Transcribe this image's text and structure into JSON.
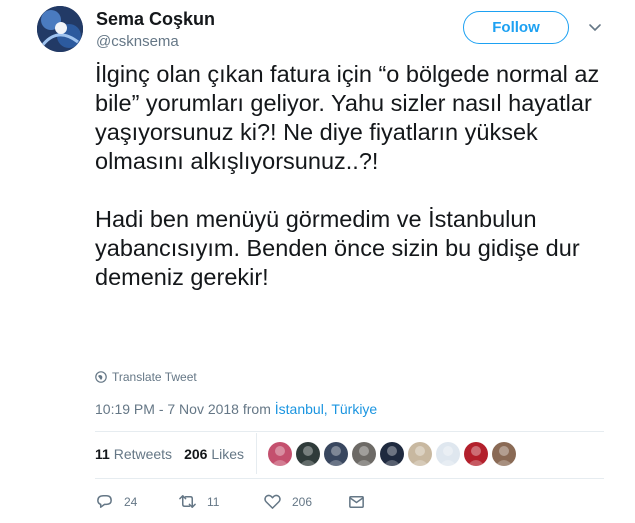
{
  "user": {
    "name": "Sema Coşkun",
    "handle": "@csknsema",
    "follow_label": "Follow"
  },
  "tweet": {
    "paragraph1": "İlginç olan çıkan fatura için “o bölgede normal az bile” yorumları geliyor. Yahu sizler nasıl hayatlar yaşıyorsunuz ki?! Ne diye fiyatların yüksek olmasını alkışlıyorsunuz..?!",
    "paragraph2": "Hadi ben menüyü görmedim ve İstanbulun yabancısıyım. Benden önce sizin bu gidişe dur demeniz gerekir!",
    "translate_label": "Translate Tweet",
    "timestamp": "10:19 PM - 7 Nov 2018 from",
    "location": "İstanbul, Türkiye"
  },
  "stats": {
    "retweets_count": "11",
    "retweets_label": "Retweets",
    "likes_count": "206",
    "likes_label": "Likes"
  },
  "likers": [
    {
      "icon": "liker-avatar",
      "color": "#c4506e"
    },
    {
      "icon": "liker-avatar",
      "color": "#2f3b3a"
    },
    {
      "icon": "liker-avatar",
      "color": "#39475f"
    },
    {
      "icon": "liker-avatar",
      "color": "#6d6a66"
    },
    {
      "icon": "liker-avatar",
      "color": "#1f2a3f"
    },
    {
      "icon": "liker-avatar",
      "color": "#c8b8a0"
    },
    {
      "icon": "liker-avatar",
      "color": "#dfe7ef"
    },
    {
      "icon": "liker-avatar",
      "color": "#b3202c"
    },
    {
      "icon": "liker-avatar",
      "color": "#8a6a55"
    }
  ],
  "actions": {
    "replies": "24",
    "retweets": "11",
    "likes": "206"
  },
  "colors": {
    "accent": "#1da1f2",
    "link": "#1b95e0",
    "muted": "#657786",
    "text": "#14171a"
  }
}
